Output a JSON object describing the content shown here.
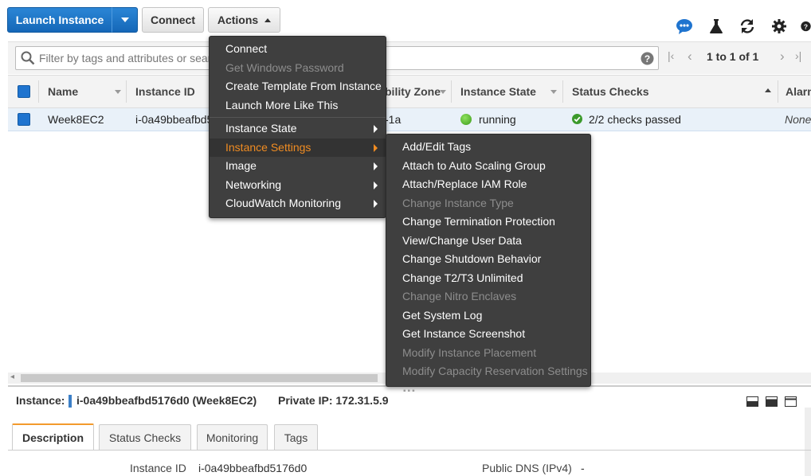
{
  "toolbar": {
    "launch_label": "Launch Instance",
    "connect_label": "Connect",
    "actions_label": "Actions",
    "icons": [
      "chat-icon",
      "flask-icon",
      "refresh-icon",
      "gear-icon",
      "help-icon"
    ]
  },
  "filter": {
    "placeholder": "Filter by tags and attributes or search",
    "pagination": "1 to 1 of 1"
  },
  "table": {
    "columns": [
      "Name",
      "Instance ID",
      "bility Zone",
      "Instance State",
      "Status Checks",
      "Alarm"
    ],
    "row": {
      "name": "Week8EC2",
      "instance_id": "i-0a49bbeafbd5",
      "zone": "-1a",
      "state": "running",
      "status": "2/2 checks passed",
      "alarm": "None"
    }
  },
  "details": {
    "instance_label": "Instance:",
    "instance_value": "i-0a49bbeafbd5176d0 (Week8EC2)",
    "private_ip": "Private IP: 172.31.5.9",
    "tabs": [
      "Description",
      "Status Checks",
      "Monitoring",
      "Tags"
    ],
    "fields": {
      "instance_id_label": "Instance ID",
      "instance_id_value": "i-0a49bbeafbd5176d0",
      "public_dns_label": "Public DNS (IPv4)",
      "public_dns_value": "-"
    }
  },
  "actions_menu": {
    "items": [
      {
        "label": "Connect",
        "disabled": false
      },
      {
        "label": "Get Windows Password",
        "disabled": true
      },
      {
        "label": "Create Template From Instance",
        "disabled": false
      },
      {
        "label": "Launch More Like This",
        "disabled": false
      },
      {
        "label": "Instance State",
        "disabled": false,
        "submenu": true
      },
      {
        "label": "Instance Settings",
        "disabled": false,
        "submenu": true,
        "highlighted": true
      },
      {
        "label": "Image",
        "disabled": false,
        "submenu": true
      },
      {
        "label": "Networking",
        "disabled": false,
        "submenu": true
      },
      {
        "label": "CloudWatch Monitoring",
        "disabled": false,
        "submenu": true
      }
    ]
  },
  "settings_submenu": {
    "items": [
      {
        "label": "Add/Edit Tags",
        "disabled": false
      },
      {
        "label": "Attach to Auto Scaling Group",
        "disabled": false
      },
      {
        "label": "Attach/Replace IAM Role",
        "disabled": false
      },
      {
        "label": "Change Instance Type",
        "disabled": true
      },
      {
        "label": "Change Termination Protection",
        "disabled": false
      },
      {
        "label": "View/Change User Data",
        "disabled": false
      },
      {
        "label": "Change Shutdown Behavior",
        "disabled": false
      },
      {
        "label": "Change T2/T3 Unlimited",
        "disabled": false
      },
      {
        "label": "Change Nitro Enclaves",
        "disabled": true
      },
      {
        "label": "Get System Log",
        "disabled": false
      },
      {
        "label": "Get Instance Screenshot",
        "disabled": false
      },
      {
        "label": "Modify Instance Placement",
        "disabled": true
      },
      {
        "label": "Modify Capacity Reservation Settings",
        "disabled": true
      }
    ]
  },
  "colors": {
    "primary": "#1f74cf",
    "menu_bg": "#3f3f3f",
    "highlight": "#f08c22",
    "running": "#4caf2b",
    "ok": "#3c9a2c"
  }
}
